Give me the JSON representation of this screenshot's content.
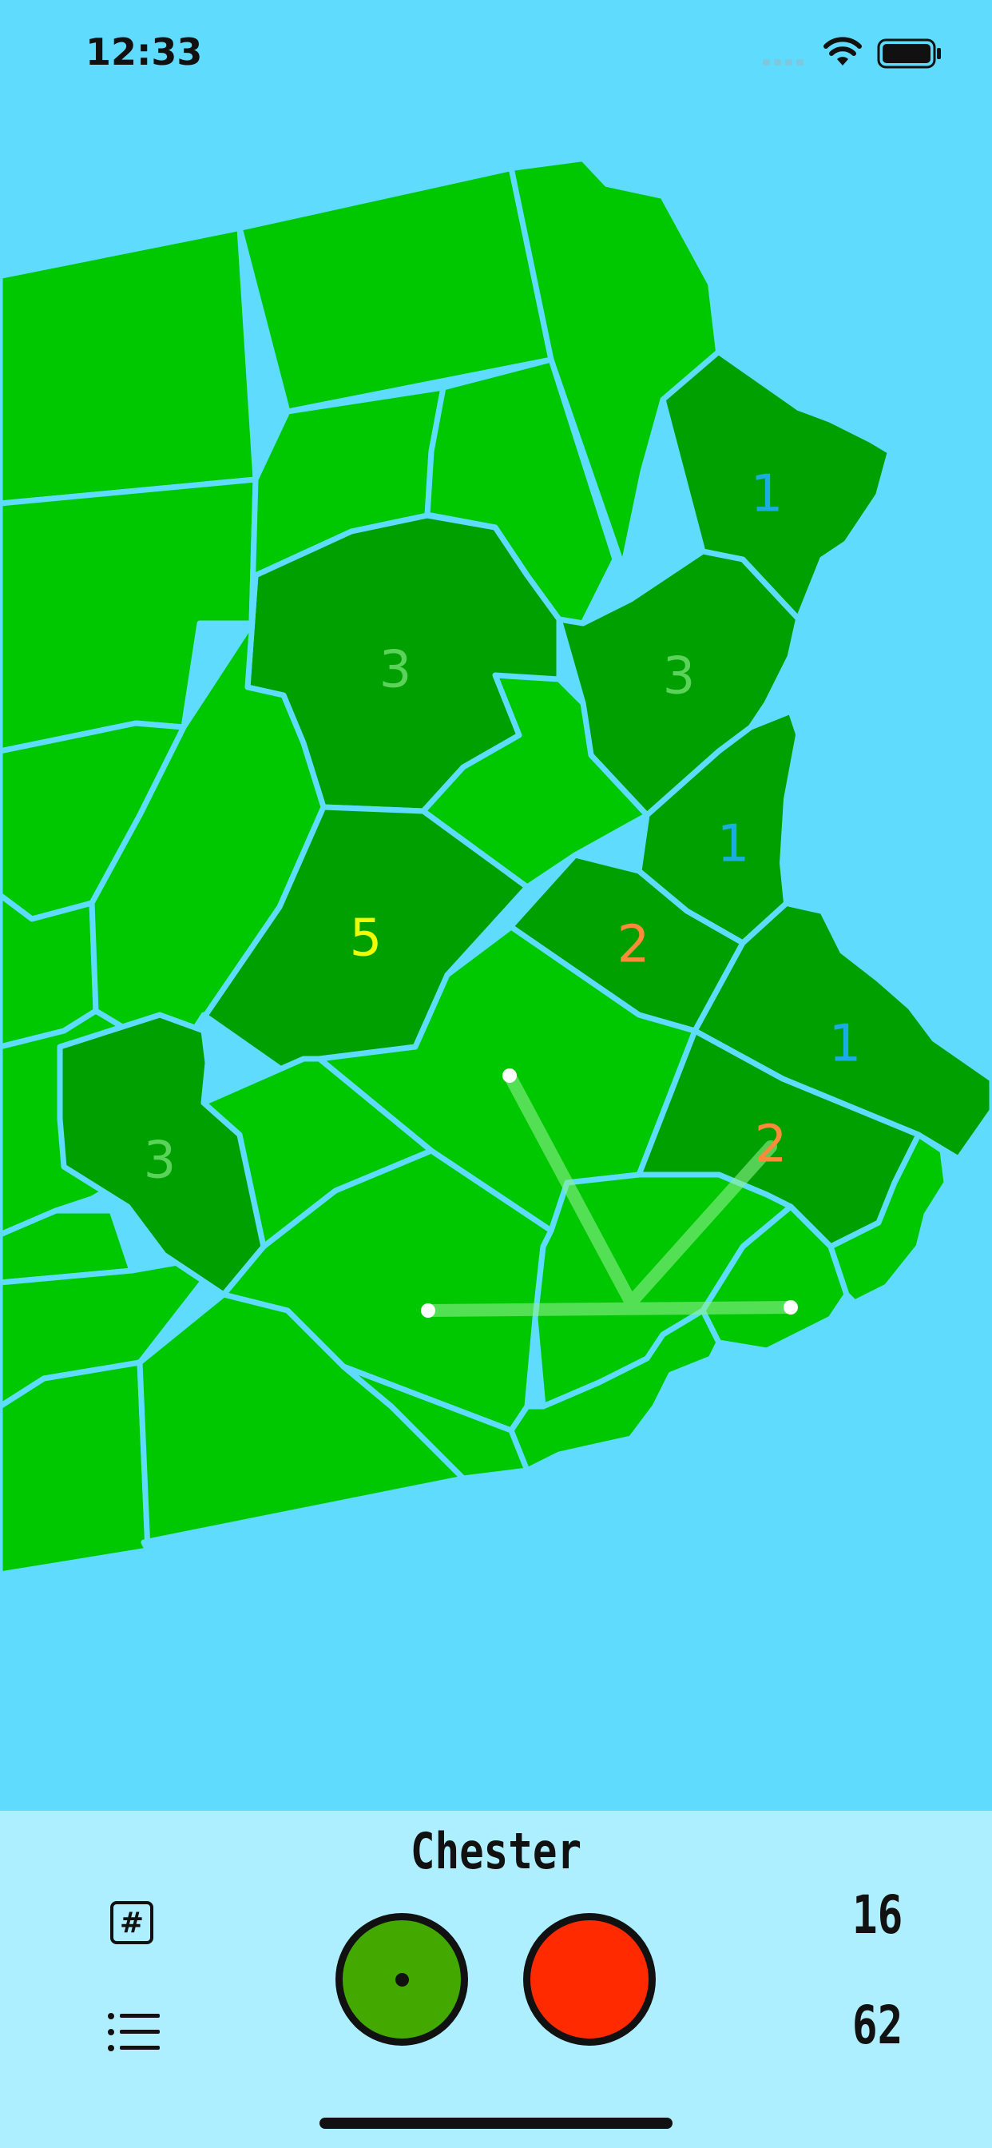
{
  "status_bar": {
    "time": "12:33"
  },
  "map": {
    "clues": [
      {
        "id": "ne",
        "value": "1",
        "color": "#1aaee0"
      },
      {
        "id": "nw-center",
        "value": "3",
        "color": "#5bd35b"
      },
      {
        "id": "ne-center",
        "value": "3",
        "color": "#5bd35b"
      },
      {
        "id": "east-mid",
        "value": "1",
        "color": "#1aaee0"
      },
      {
        "id": "center",
        "value": "5",
        "color": "#f0ff00"
      },
      {
        "id": "center-east",
        "value": "2",
        "color": "#ff8a3a"
      },
      {
        "id": "far-east",
        "value": "1",
        "color": "#1aaee0"
      },
      {
        "id": "southwest",
        "value": "3",
        "color": "#5bd35b"
      },
      {
        "id": "southeast",
        "value": "2",
        "color": "#ff8a3a"
      }
    ]
  },
  "panel": {
    "county_name": "Chester",
    "hash_icon": "#",
    "count_top": "16",
    "count_bottom": "62"
  },
  "colors": {
    "water": "#5fdcfd",
    "county_light": "#00c800",
    "county_dark": "#00a000",
    "panel": "#adefff",
    "green_button": "#43a800",
    "red_button": "#ff2a00"
  },
  "icons": [
    "wifi-icon",
    "battery-icon",
    "signal-icon",
    "hash-icon",
    "list-icon"
  ]
}
